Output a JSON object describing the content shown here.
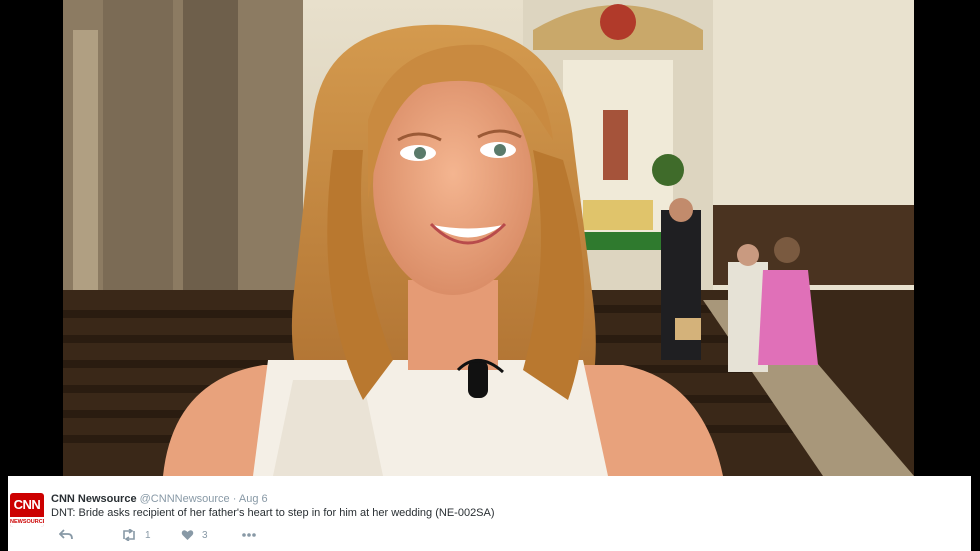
{
  "video": {
    "description_icon": "video-frame"
  },
  "tweet": {
    "avatar": {
      "brand": "CNN",
      "sub": "NEWSOURCE",
      "color": "#cc0000"
    },
    "name": "CNN Newsource",
    "handle": "@CNNNewsource",
    "separator": "·",
    "date": "Aug 6",
    "text": "DNT: Bride asks recipient of her father's heart to step in for him at her wedding (NE-002SA)",
    "actions": {
      "reply_icon": "reply-icon",
      "retweet_count": "1",
      "like_count": "3",
      "more_icon": "more-icon"
    }
  }
}
